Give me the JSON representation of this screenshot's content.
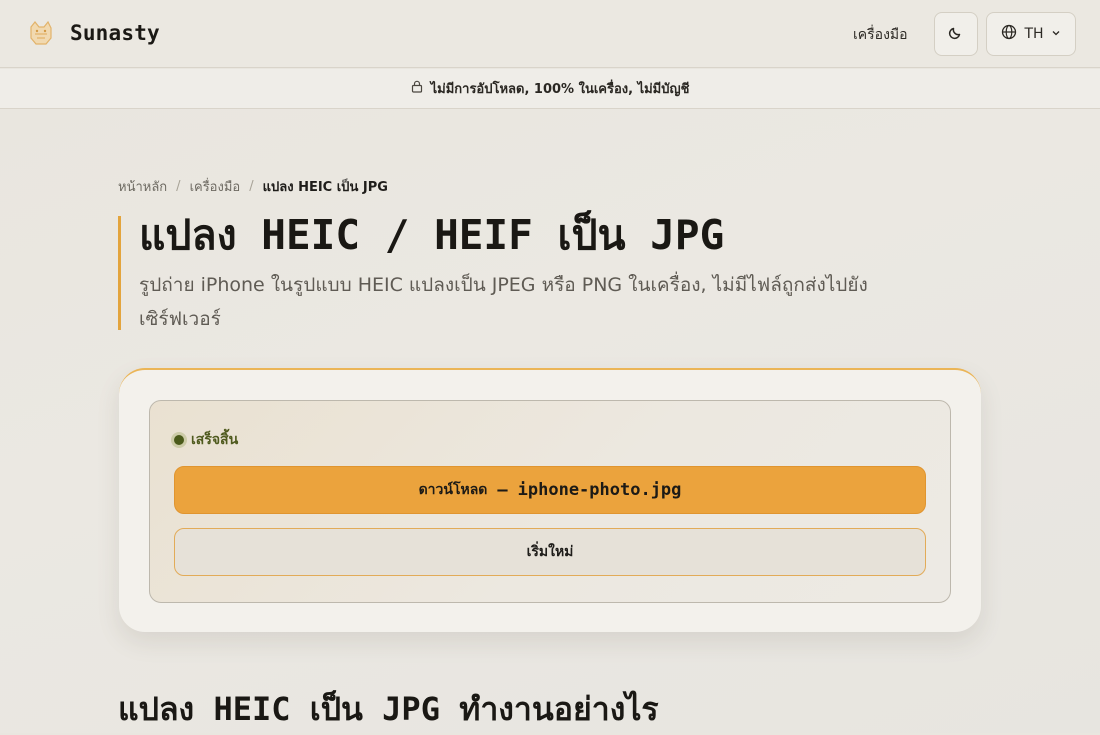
{
  "header": {
    "brand": "Sunasty",
    "nav_tools": "เครื่องมือ",
    "lang": "TH",
    "logo_icon": "fox-logo-icon",
    "theme_icon": "moon-icon",
    "lang_icon": "globe-icon"
  },
  "notice": {
    "text": "ไม่มีการอัปโหลด, 100% ในเครื่อง, ไม่มีบัญชี",
    "icon": "lock-icon"
  },
  "breadcrumb": {
    "home": "หน้าหลัก",
    "tools": "เครื่องมือ",
    "current": "แปลง HEIC เป็น JPG"
  },
  "page": {
    "title": "แปลง HEIC / HEIF เป็น JPG",
    "subtitle": "รูปถ่าย iPhone ในรูปแบบ HEIC แปลงเป็น JPEG หรือ PNG ในเครื่อง, ไม่มีไฟล์ถูกส่งไปยังเซิร์ฟเวอร์"
  },
  "converter": {
    "status": "เสร็จสิ้น",
    "download_label": "ดาวน์โหลด",
    "download_sep": "—",
    "filename": "iphone-photo.jpg",
    "restart_label": "เริ่มใหม่"
  },
  "section": {
    "heading": "แปลง HEIC เป็น JPG ทำงานอย่างไร"
  },
  "colors": {
    "accent": "#eba33d",
    "success": "#4b5a1a",
    "background": "#e9e6df"
  }
}
